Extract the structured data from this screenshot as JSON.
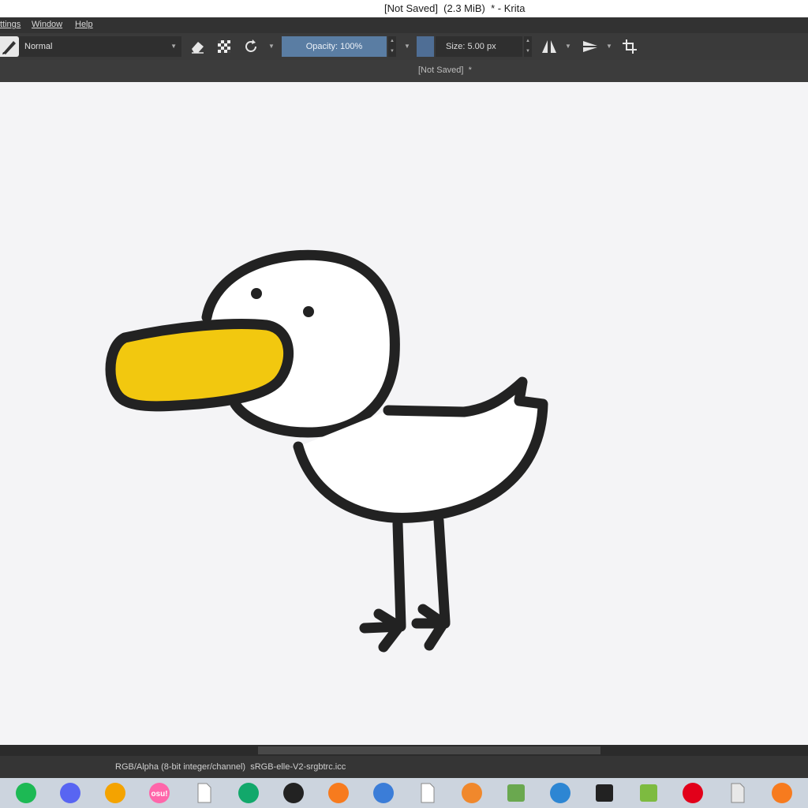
{
  "window": {
    "title": "[Not Saved]  (2.3 MiB)  * - Krita"
  },
  "menu": [
    "ttings",
    "Window",
    "Help"
  ],
  "toolbar": {
    "brush_preset_icon": "pen-preset-icon",
    "blend_mode": "Normal",
    "eraser_icon": "eraser-icon",
    "alpha_icon": "checker-alpha-icon",
    "reload_icon": "reload-preset-icon",
    "opacity_label": "Opacity: 100%",
    "fg_color": "#4f6e95",
    "size_label": "Size: 5.00 px",
    "mirror_h_icon": "mirror-horizontal-icon",
    "mirror_v_icon": "mirror-vertical-icon",
    "wrap_icon": "crop-wrap-icon"
  },
  "document_tab": {
    "label": "[Not Saved]  *"
  },
  "canvas": {
    "background": "#f4f4f6",
    "drawing": "duck-drawing",
    "beak_color": "#f2c80f",
    "stroke_color": "#222222"
  },
  "status": {
    "color_info": "RGB/Alpha (8-bit integer/channel)  sRGB-elle-V2-srgbtrc.icc"
  },
  "taskbar": {
    "apps": [
      {
        "name": "spotify-icon",
        "color": "#1db954"
      },
      {
        "name": "discord-icon",
        "color": "#5865f2"
      },
      {
        "name": "audacity-icon",
        "color": "#f4a300"
      },
      {
        "name": "osu-icon",
        "color": "#ff66aa",
        "text": "osu!"
      },
      {
        "name": "file-icon",
        "color": "#ffffff"
      },
      {
        "name": "app-green-icon",
        "color": "#12a86b"
      },
      {
        "name": "heart-pixel-icon",
        "color": "#222222"
      },
      {
        "name": "fl-studio-icon",
        "color": "#f77b1e"
      },
      {
        "name": "globe-icon",
        "color": "#3b7dd8"
      },
      {
        "name": "ghost-icon",
        "color": "#ffffff"
      },
      {
        "name": "blender-icon",
        "color": "#f0882c"
      },
      {
        "name": "minecraft-icon",
        "color": "#6aa84f"
      },
      {
        "name": "vscode-icon",
        "color": "#2d86d3"
      },
      {
        "name": "unity-icon",
        "color": "#222222"
      },
      {
        "name": "chart-app-icon",
        "color": "#7dbb40"
      },
      {
        "name": "red-app-icon",
        "color": "#e2001a"
      },
      {
        "name": "krita-taskbar-icon",
        "color": "#e8e8e8"
      },
      {
        "name": "fl-studio-icon-2",
        "color": "#f77b1e"
      }
    ]
  }
}
